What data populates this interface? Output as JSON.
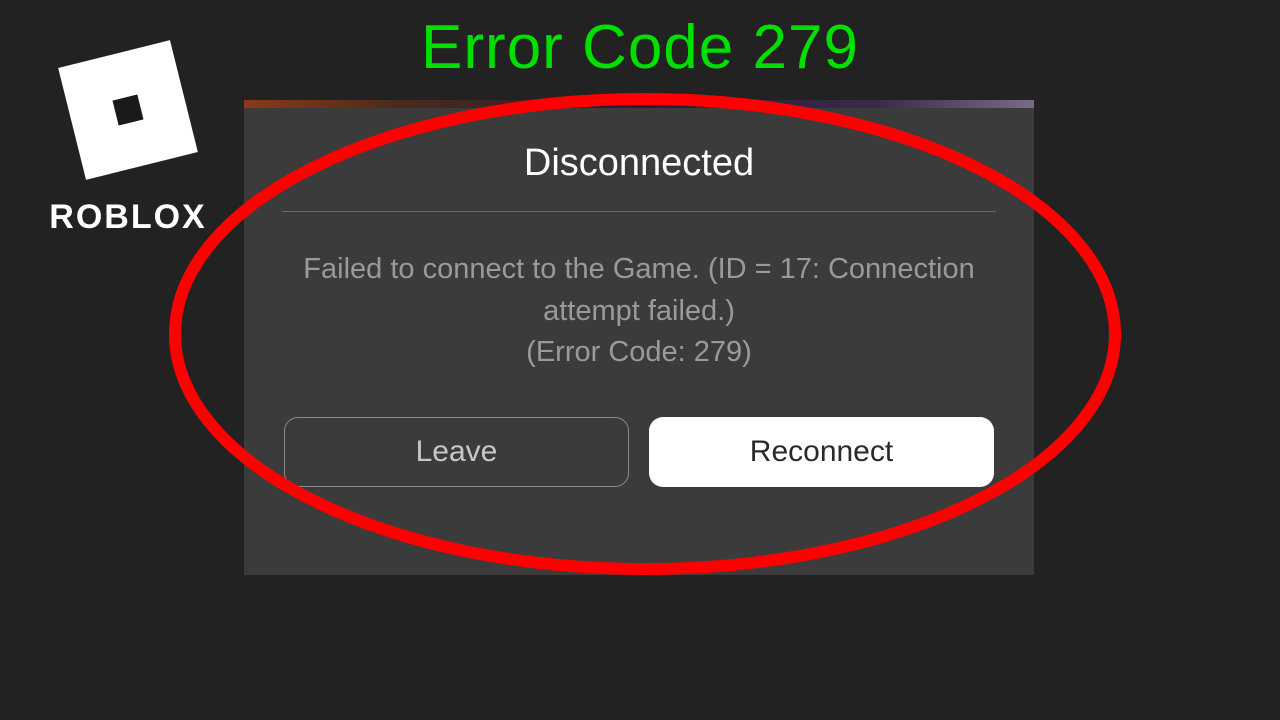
{
  "page": {
    "title": "Error Code 279",
    "title_color": "#00e000"
  },
  "logo": {
    "brand_text": "ROBLOX"
  },
  "dialog": {
    "title": "Disconnected",
    "message": "Failed to connect to the Game. (ID = 17: Connection attempt failed.)",
    "error_line": "(Error Code: 279)",
    "buttons": {
      "leave": "Leave",
      "reconnect": "Reconnect"
    }
  },
  "annotation": {
    "oval_stroke": "#ff0000",
    "oval_stroke_width": 12
  }
}
